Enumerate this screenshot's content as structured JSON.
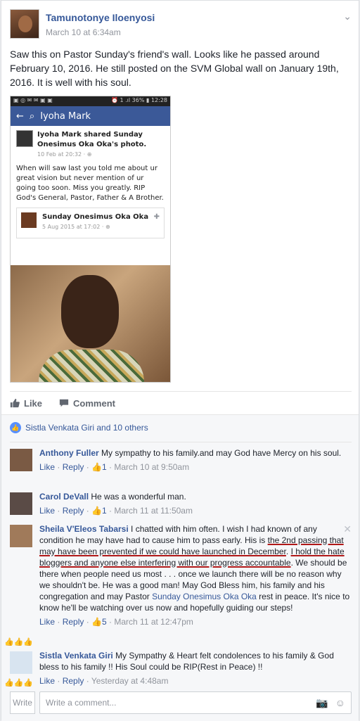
{
  "post": {
    "author": "Tamunotonye Iloenyosi",
    "timestamp": "March 10 at 6:34am",
    "text": "Saw this on Pastor Sunday's friend's wall. Looks like he passed around February 10, 2016. He still posted on the SVM Global wall on January 19th, 2016. It is well with his soul."
  },
  "screenshot": {
    "status_left": "▣ ◎ ✉ ✉ ▣ ▣",
    "status_right": "⏰ 1 .ıl 36% ▮ 12:28",
    "search_query": "Iyoha Mark",
    "inner_author_line": "Iyoha Mark shared Sunday Onesimus Oka Oka's photo.",
    "inner_time": "10 Feb at 20:32 · ⊕",
    "inner_text": "When will saw last you told me about ur great vision but never mention of ur going too soon. Miss you greatly. RIP God's General, Pastor, Father & A Brother.",
    "shared_name": "Sunday Onesimus Oka Oka",
    "shared_time": "5 Aug 2015 at 17:02 · ⊕"
  },
  "actions": {
    "like": "Like",
    "comment": "Comment"
  },
  "likers": "Sistla Venkata Giri and 10 others",
  "comments": [
    {
      "name": "Anthony Fuller",
      "text": "My sympathy to his family.and may God have Mercy on his soul.",
      "like": "Like",
      "reply": "Reply",
      "count": "1",
      "time": "March 10 at 9:50am"
    },
    {
      "name": "Carol DeVall",
      "text": "He was a wonderful man.",
      "like": "Like",
      "reply": "Reply",
      "count": "1",
      "time": "March 11 at 11:50am"
    },
    {
      "name": "Sheila V'Eleos Tabarsi",
      "text_a": "I chatted with him often. I wish I had known of any condition he may have had to cause him to pass early. His is ",
      "text_u1": "the 2nd passing that may have been prevented if we could have launched in December",
      "text_b": ". ",
      "text_u2": "I hold the hate bloggers and anyone else interfering with our progress accountable",
      "text_c": ". We should be there when people need us most . . . once we launch there will be no reason why we shouldn't be. He was a good man! May God Bless him, his family and his congregation and may Pastor ",
      "mention": "Sunday Onesimus Oka Oka",
      "text_d": " rest in peace. It's nice to know he'll be watching over us now and hopefully guiding our steps!",
      "like": "Like",
      "reply": "Reply",
      "count": "5",
      "time": "March 11 at 12:47pm"
    },
    {
      "name": "Sistla Venkata Giri",
      "text": "My Sympathy & Heart felt condolences to his family & God bless to his family !! His Soul could be RIP(Rest in Peace) !!",
      "like": "Like",
      "reply": "Reply",
      "time": "Yesterday at 4:48am"
    }
  ],
  "composer": {
    "write_label": "Write",
    "placeholder": "Write a comment..."
  },
  "colors": {
    "link": "#365899",
    "meta": "#90949c",
    "underline": "#b01818"
  }
}
